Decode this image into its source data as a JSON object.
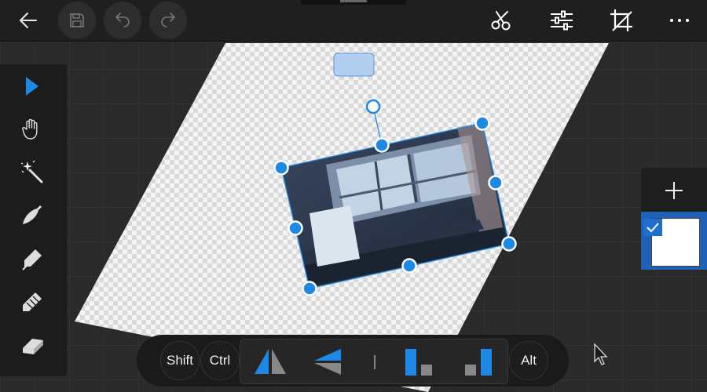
{
  "topbar": {
    "back": "back-arrow-icon",
    "save": "save-icon",
    "undo": "undo-icon",
    "redo": "redo-icon",
    "cut": "scissors-icon",
    "adjust": "sliders-icon",
    "crop": "crop-icon",
    "more": "more-icon"
  },
  "tools": [
    "select-arrow",
    "hand-pan",
    "magic-wand",
    "brush",
    "marker",
    "pencil",
    "eraser"
  ],
  "bottombar": {
    "shift_label": "Shift",
    "ctrl_label": "Ctrl",
    "alt_label": "Alt"
  },
  "colors": {
    "accent": "#1e88e5",
    "selection": "#1f6fd1",
    "toolbar_bg": "#1f1f1f"
  }
}
